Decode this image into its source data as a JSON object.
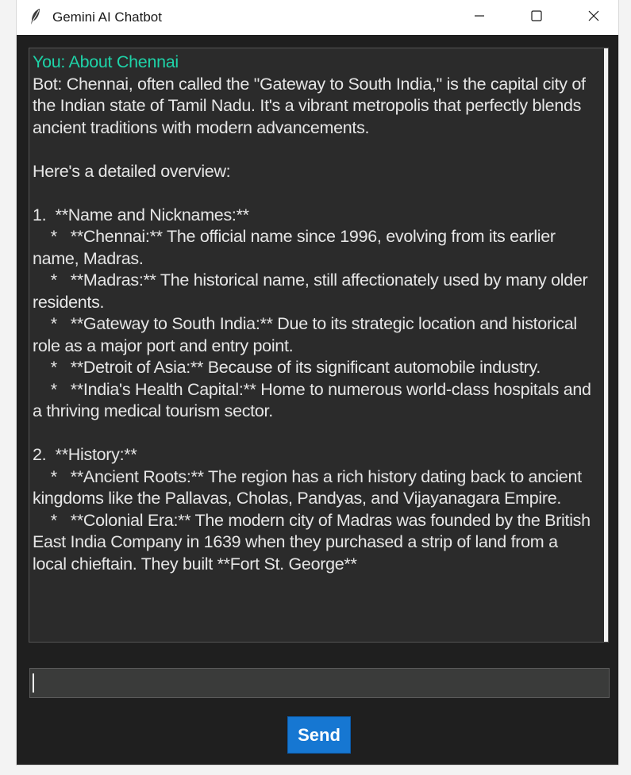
{
  "window": {
    "title": "Gemini AI Chatbot"
  },
  "titlebar_icons": {
    "app": "feather-icon",
    "minimize": "minimize-icon",
    "maximize": "maximize-icon",
    "close": "close-icon"
  },
  "chat": {
    "user_message": "You: About Chennai",
    "bot_message": "Bot: Chennai, often called the \"Gateway to South India,\" is the capital city of the Indian state of Tamil Nadu. It's a vibrant metropolis that perfectly blends ancient traditions with modern advancements.\n\nHere's a detailed overview:\n\n1.  **Name and Nicknames:**\n    *   **Chennai:** The official name since 1996, evolving from its earlier name, Madras.\n    *   **Madras:** The historical name, still affectionately used by many older residents.\n    *   **Gateway to South India:** Due to its strategic location and historical role as a major port and entry point.\n    *   **Detroit of Asia:** Because of its significant automobile industry.\n    *   **India's Health Capital:** Home to numerous world-class hospitals and a thriving medical tourism sector.\n\n2.  **History:**\n    *   **Ancient Roots:** The region has a rich history dating back to ancient kingdoms like the Pallavas, Cholas, Pandyas, and Vijayanagara Empire.\n    *   **Colonial Era:** The modern city of Madras was founded by the British East India Company in 1639 when they purchased a strip of land from a local chieftain. They built **Fort St. George**"
  },
  "input": {
    "value": ""
  },
  "send_button": {
    "label": "Send"
  },
  "colors": {
    "user_text": "#1ed3a8",
    "bot_text": "#e6e6e6",
    "chat_bg": "#2b2b2b",
    "window_bg": "#1f1f1f",
    "send_bg": "#1677d2"
  }
}
